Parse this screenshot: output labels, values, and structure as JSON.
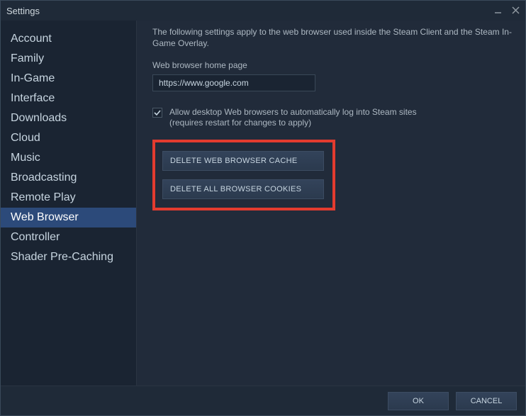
{
  "title": "Settings",
  "sidebar": {
    "items": [
      {
        "label": "Account"
      },
      {
        "label": "Family"
      },
      {
        "label": "In-Game"
      },
      {
        "label": "Interface"
      },
      {
        "label": "Downloads"
      },
      {
        "label": "Cloud"
      },
      {
        "label": "Music"
      },
      {
        "label": "Broadcasting"
      },
      {
        "label": "Remote Play"
      },
      {
        "label": "Web Browser"
      },
      {
        "label": "Controller"
      },
      {
        "label": "Shader Pre-Caching"
      }
    ],
    "selected_index": 9
  },
  "content": {
    "description": "The following settings apply to the web browser used inside the Steam Client and the Steam In-Game Overlay.",
    "homepage_label": "Web browser home page",
    "homepage_value": "https://www.google.com",
    "autologin_checked": true,
    "autologin_line1": "Allow desktop Web browsers to automatically log into Steam sites",
    "autologin_line2": "(requires restart for changes to apply)",
    "delete_cache_label": "DELETE WEB BROWSER CACHE",
    "delete_cookies_label": "DELETE ALL BROWSER COOKIES"
  },
  "footer": {
    "ok_label": "OK",
    "cancel_label": "CANCEL"
  },
  "colors": {
    "highlight_red": "#e33b2f",
    "selected_bg": "#2c4a7a"
  }
}
